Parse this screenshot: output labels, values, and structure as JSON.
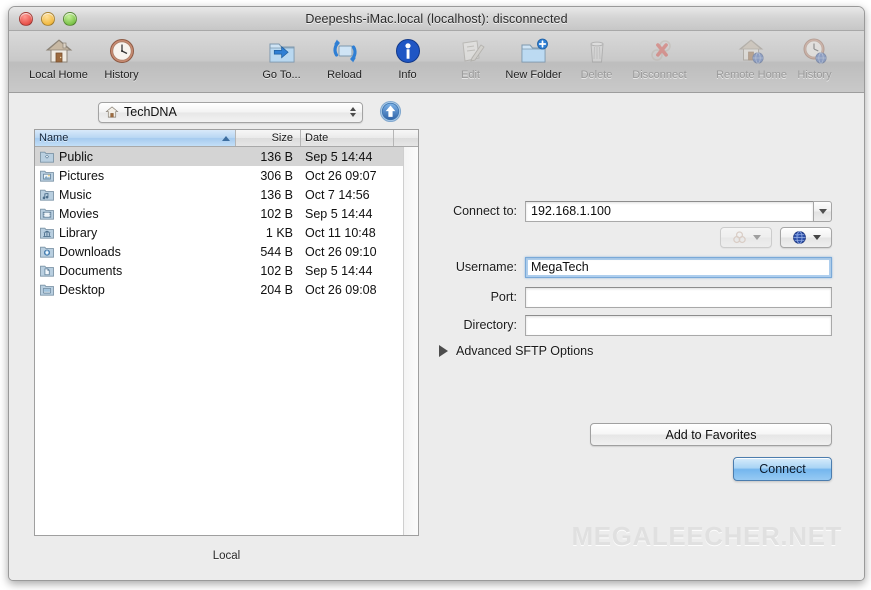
{
  "window": {
    "title": "Deepeshs-iMac.local (localhost): disconnected",
    "traffic": {
      "close_label": "close",
      "minimize_label": "minimize",
      "zoom_label": "zoom"
    }
  },
  "toolbar": {
    "left": [
      {
        "label": "Local Home",
        "icon": "home-icon",
        "enabled": true
      },
      {
        "label": "History",
        "icon": "clock-icon",
        "enabled": true
      }
    ],
    "center": [
      {
        "label": "Go To...",
        "icon": "goto-folder-icon",
        "enabled": true
      },
      {
        "label": "Reload",
        "icon": "reload-icon",
        "enabled": true
      },
      {
        "label": "Info",
        "icon": "info-icon",
        "enabled": true
      },
      {
        "label": "Edit",
        "icon": "edit-pencil-icon",
        "enabled": false
      },
      {
        "label": "New Folder",
        "icon": "new-folder-icon",
        "enabled": true
      },
      {
        "label": "Delete",
        "icon": "trash-icon",
        "enabled": false
      },
      {
        "label": "Disconnect",
        "icon": "disconnect-icon",
        "enabled": false
      }
    ],
    "right": [
      {
        "label": "Remote Home",
        "icon": "remote-home-icon",
        "enabled": false
      },
      {
        "label": "History",
        "icon": "remote-clock-icon",
        "enabled": false
      }
    ]
  },
  "left_pane": {
    "path_popup": {
      "label": "TechDNA",
      "icon": "home-icon"
    },
    "up_button": {
      "icon": "up-arrow-circle-icon"
    },
    "columns": [
      {
        "key": "name",
        "label": "Name",
        "sorted": true,
        "sort_direction": "ascending"
      },
      {
        "key": "size",
        "label": "Size",
        "sorted": false
      },
      {
        "key": "date",
        "label": "Date",
        "sorted": false
      }
    ],
    "rows": [
      {
        "name": "Public",
        "size": "136 B",
        "date": "Sep 5 14:44",
        "icon": "folder-public-icon",
        "selected": true
      },
      {
        "name": "Pictures",
        "size": "306 B",
        "date": "Oct 26 09:07",
        "icon": "folder-pictures-icon",
        "selected": false
      },
      {
        "name": "Music",
        "size": "136 B",
        "date": "Oct 7 14:56",
        "icon": "folder-music-icon",
        "selected": false
      },
      {
        "name": "Movies",
        "size": "102 B",
        "date": "Sep 5 14:44",
        "icon": "folder-movies-icon",
        "selected": false
      },
      {
        "name": "Library",
        "size": "1 KB",
        "date": "Oct 11 10:48",
        "icon": "folder-library-icon",
        "selected": false
      },
      {
        "name": "Downloads",
        "size": "544 B",
        "date": "Oct 26 09:10",
        "icon": "folder-downloads-icon",
        "selected": false
      },
      {
        "name": "Documents",
        "size": "102 B",
        "date": "Sep 5 14:44",
        "icon": "folder-documents-icon",
        "selected": false
      },
      {
        "name": "Desktop",
        "size": "204 B",
        "date": "Oct 26 09:08",
        "icon": "folder-desktop-icon",
        "selected": false
      }
    ],
    "status_label": "Local"
  },
  "connect_form": {
    "connect_to": {
      "label": "Connect to:",
      "value": "192.168.1.100",
      "placeholder": ""
    },
    "bonjour_button": {
      "icon": "bonjour-icon",
      "enabled": false
    },
    "globe_button": {
      "icon": "globe-icon",
      "enabled": true
    },
    "username": {
      "label": "Username:",
      "value": "MegaTech",
      "placeholder": "",
      "focused": true
    },
    "port": {
      "label": "Port:",
      "value": "",
      "placeholder": ""
    },
    "directory": {
      "label": "Directory:",
      "value": "",
      "placeholder": ""
    },
    "advanced_options": {
      "label": "Advanced SFTP Options",
      "expanded": false,
      "icon": "disclosure-triangle-icon"
    },
    "add_to_favorites_label": "Add to Favorites",
    "connect_label": "Connect"
  },
  "watermark": "MEGALEECHER.NET",
  "colors": {
    "accent_blue": "#74b6ee",
    "selection_gray": "#d4d4d4",
    "sorted_header": "#a6cbef",
    "window_chrome": "#ececec",
    "watermark_gray": "#e0e0e0"
  }
}
